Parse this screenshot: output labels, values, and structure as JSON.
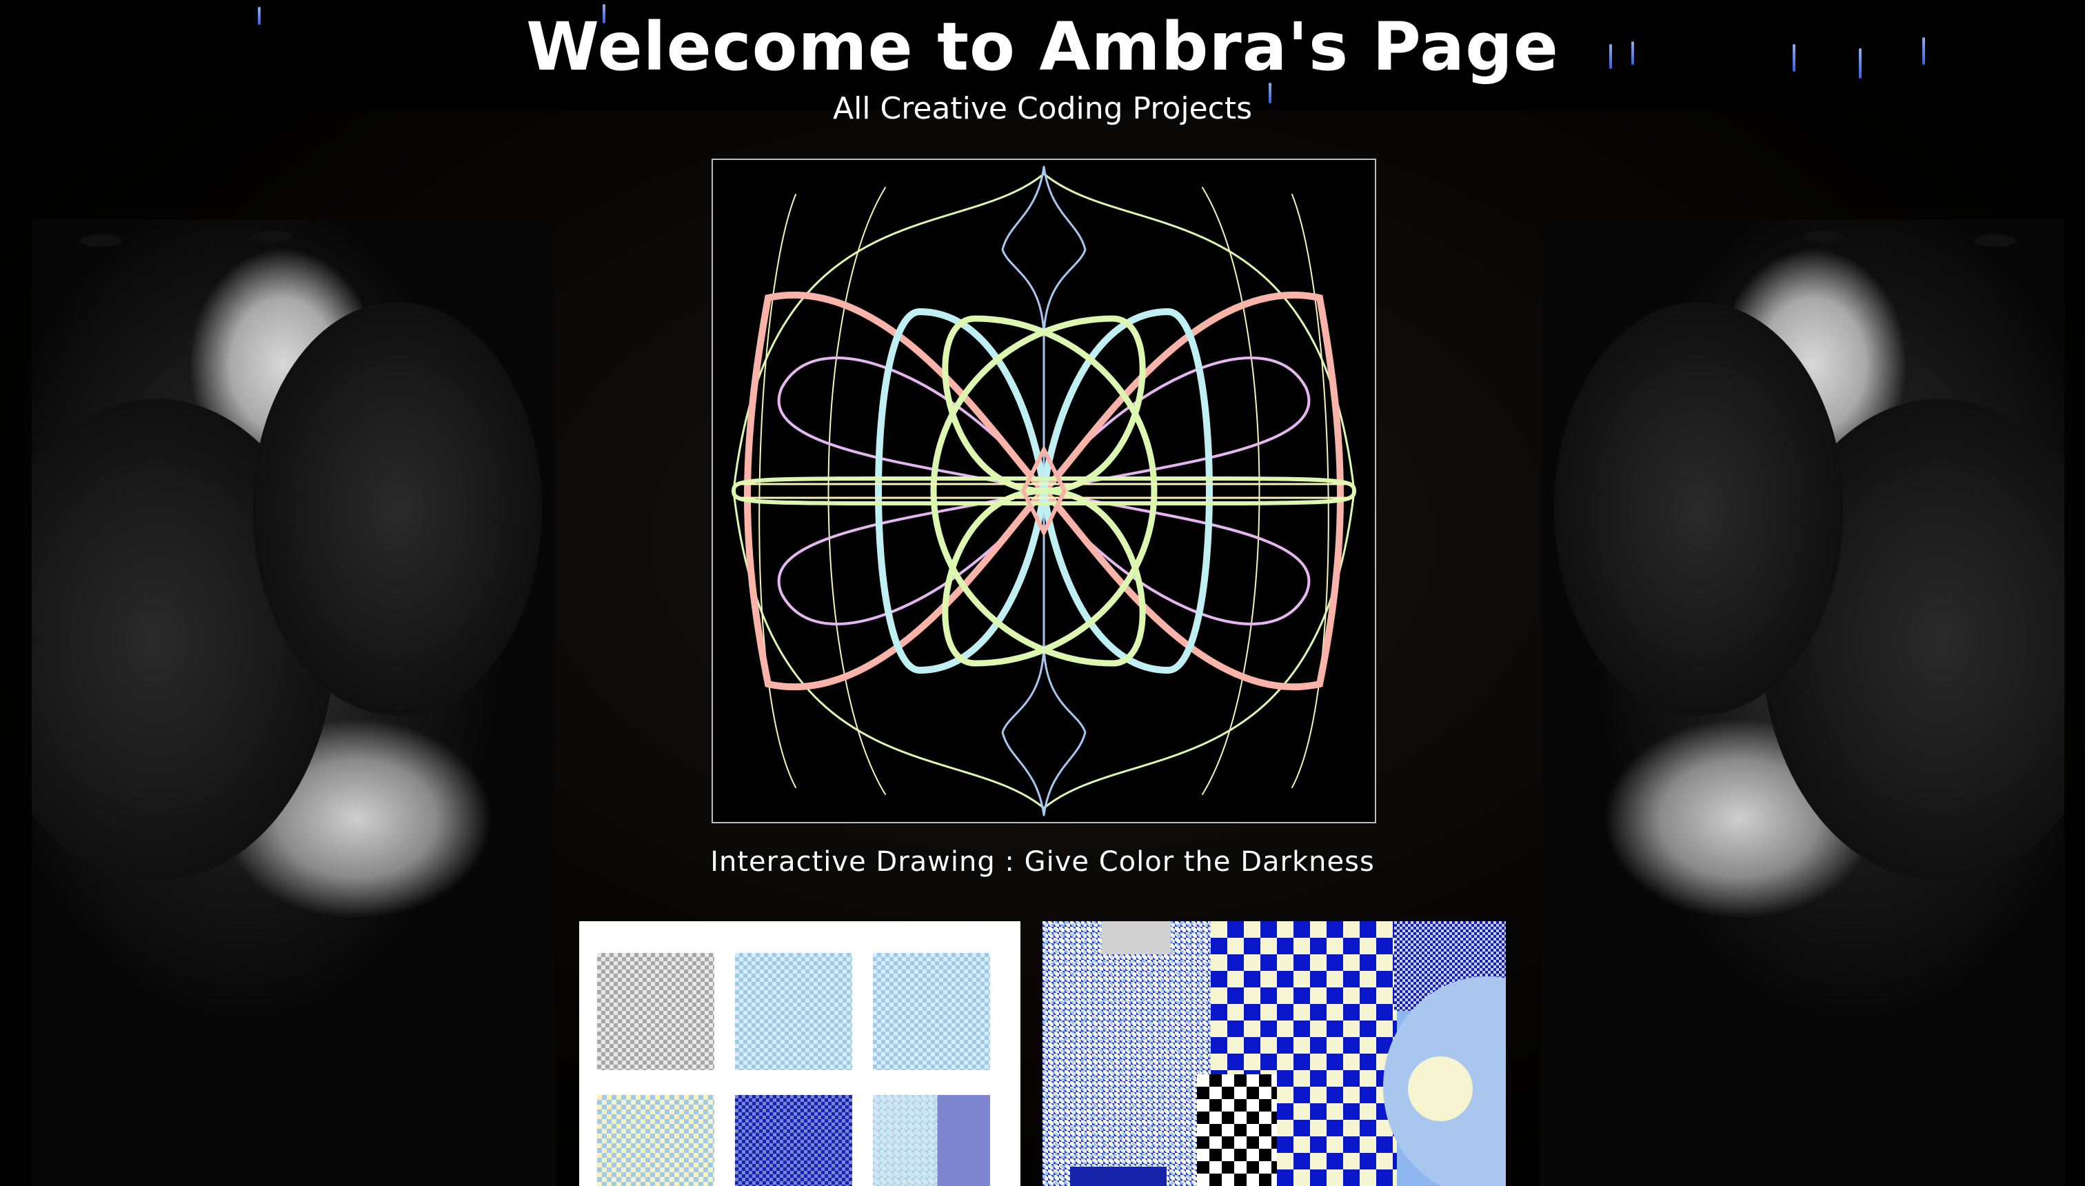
{
  "header": {
    "title": "Welecome to Ambra's Page",
    "subtitle": "All Creative Coding Projects"
  },
  "featured": {
    "caption": "Interactive Drawing : Give Color the Darkness",
    "palette": {
      "pink": "#f9b3a8",
      "lavender": "#e6b6f0",
      "cyan": "#bfeff2",
      "lime": "#dcf7b0",
      "yellow": "#f4f4b8",
      "blue": "#a9c7ee"
    }
  },
  "gallery": {
    "colors": {
      "navy": "#0a18c9",
      "sky": "#8fb7ef",
      "cream": "#f7f4d2"
    }
  },
  "theme": {
    "background": "#000000",
    "text": "#ffffff",
    "sparkle": "#6e95ff"
  }
}
